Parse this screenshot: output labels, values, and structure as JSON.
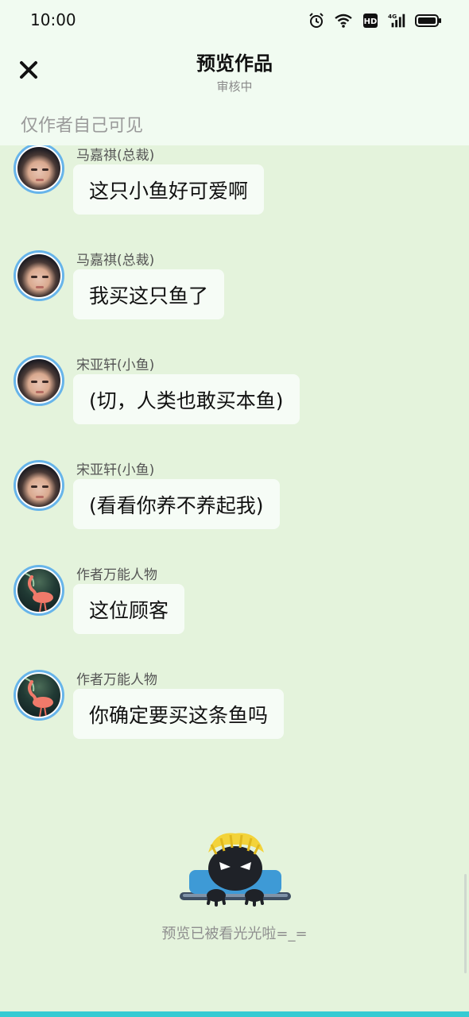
{
  "status_bar": {
    "time": "10:00",
    "icons": [
      "alarm-icon",
      "wifi-icon",
      "hd-icon",
      "signal-4g-icon",
      "battery-icon"
    ]
  },
  "header": {
    "title": "预览作品",
    "subtitle": "审核中",
    "close_icon": "close-icon"
  },
  "visibility_note": "仅作者自己可见",
  "messages": [
    {
      "sender": "马嘉祺(总裁)",
      "text": "这只小鱼好可爱啊",
      "avatar": "person"
    },
    {
      "sender": "马嘉祺(总裁)",
      "text": "我买这只鱼了",
      "avatar": "person"
    },
    {
      "sender": "宋亚轩(小鱼)",
      "text": "(切，人类也敢买本鱼)",
      "avatar": "person"
    },
    {
      "sender": "宋亚轩(小鱼)",
      "text": "(看看你养不养起我)",
      "avatar": "person"
    },
    {
      "sender": "作者万能人物",
      "text": "这位顾客",
      "avatar": "flamingo"
    },
    {
      "sender": "作者万能人物",
      "text": "你确定要买这条鱼吗",
      "avatar": "flamingo"
    }
  ],
  "end_indicator": {
    "text": "预览已被看光光啦=_=",
    "mascot_icon": "mascot-icon"
  },
  "colors": {
    "background": "#e4f3dc",
    "header_background": "#f1fbf1",
    "bubble": "#f6fcf6",
    "avatar_border": "#67b4ea",
    "bottom_bar": "#36cbd3"
  }
}
